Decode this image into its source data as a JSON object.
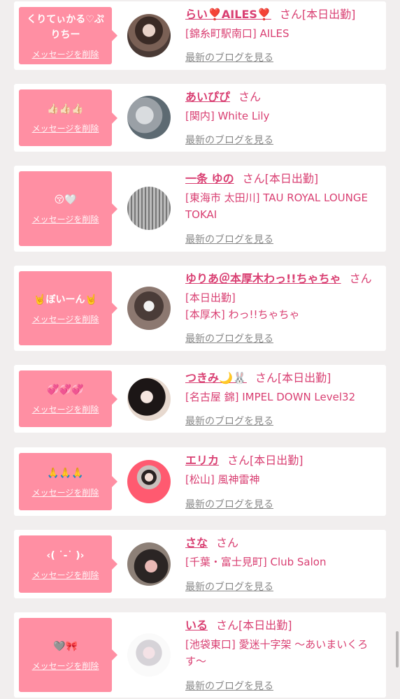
{
  "delete_label": "メッセージを削除",
  "blog_label": "最新のブログを見る",
  "san": "さん",
  "colors": {
    "bubble": "#ff8fa3",
    "accent": "#d93f72",
    "background": "#f1eeee"
  },
  "entries": [
    {
      "message": "くりてぃかる♡ぷりちー",
      "name": "らい❣️AILES❣️",
      "tag": "[本日出勤]",
      "lines": [
        "[錦糸町駅南口] AILES"
      ]
    },
    {
      "message": "👍🏻👍🏻👍🏻",
      "name": "あいぴぴ",
      "tag": "",
      "lines": [
        "[関内] White Lily"
      ]
    },
    {
      "message": "😚🤍",
      "name": "一条 ゆの",
      "tag": "[本日出勤]",
      "lines": [
        "[東海市 太田川] TAU ROYAL LOUNGE",
        "TOKAI"
      ]
    },
    {
      "message": "🤘ぼいーん🤘",
      "name": "ゆりあ＠本厚木わっ!!ちゃちゃ",
      "tag": "",
      "lines": [
        "[本日出勤]",
        "[本厚木] わっ!!ちゃちゃ"
      ]
    },
    {
      "message": "💞💞💞",
      "name": "つきみ🌙🐰",
      "tag": "[本日出勤]",
      "lines": [
        "[名古屋 錦] IMPEL DOWN Level32"
      ]
    },
    {
      "message": "🙏🙏🙏",
      "name": "エリカ",
      "tag": "[本日出勤]",
      "lines": [
        "[松山] 風神雷神"
      ]
    },
    {
      "message": "‹( ˙-˙ )›",
      "name": "さな",
      "tag": "",
      "lines": [
        "[千葉・富士見町] Club Salon"
      ]
    },
    {
      "message": "🩶🎀",
      "name": "いる",
      "tag": "[本日出勤]",
      "lines": [
        "[池袋東口] 愛迷十字架 〜あいまいくろ",
        "す〜"
      ]
    }
  ]
}
